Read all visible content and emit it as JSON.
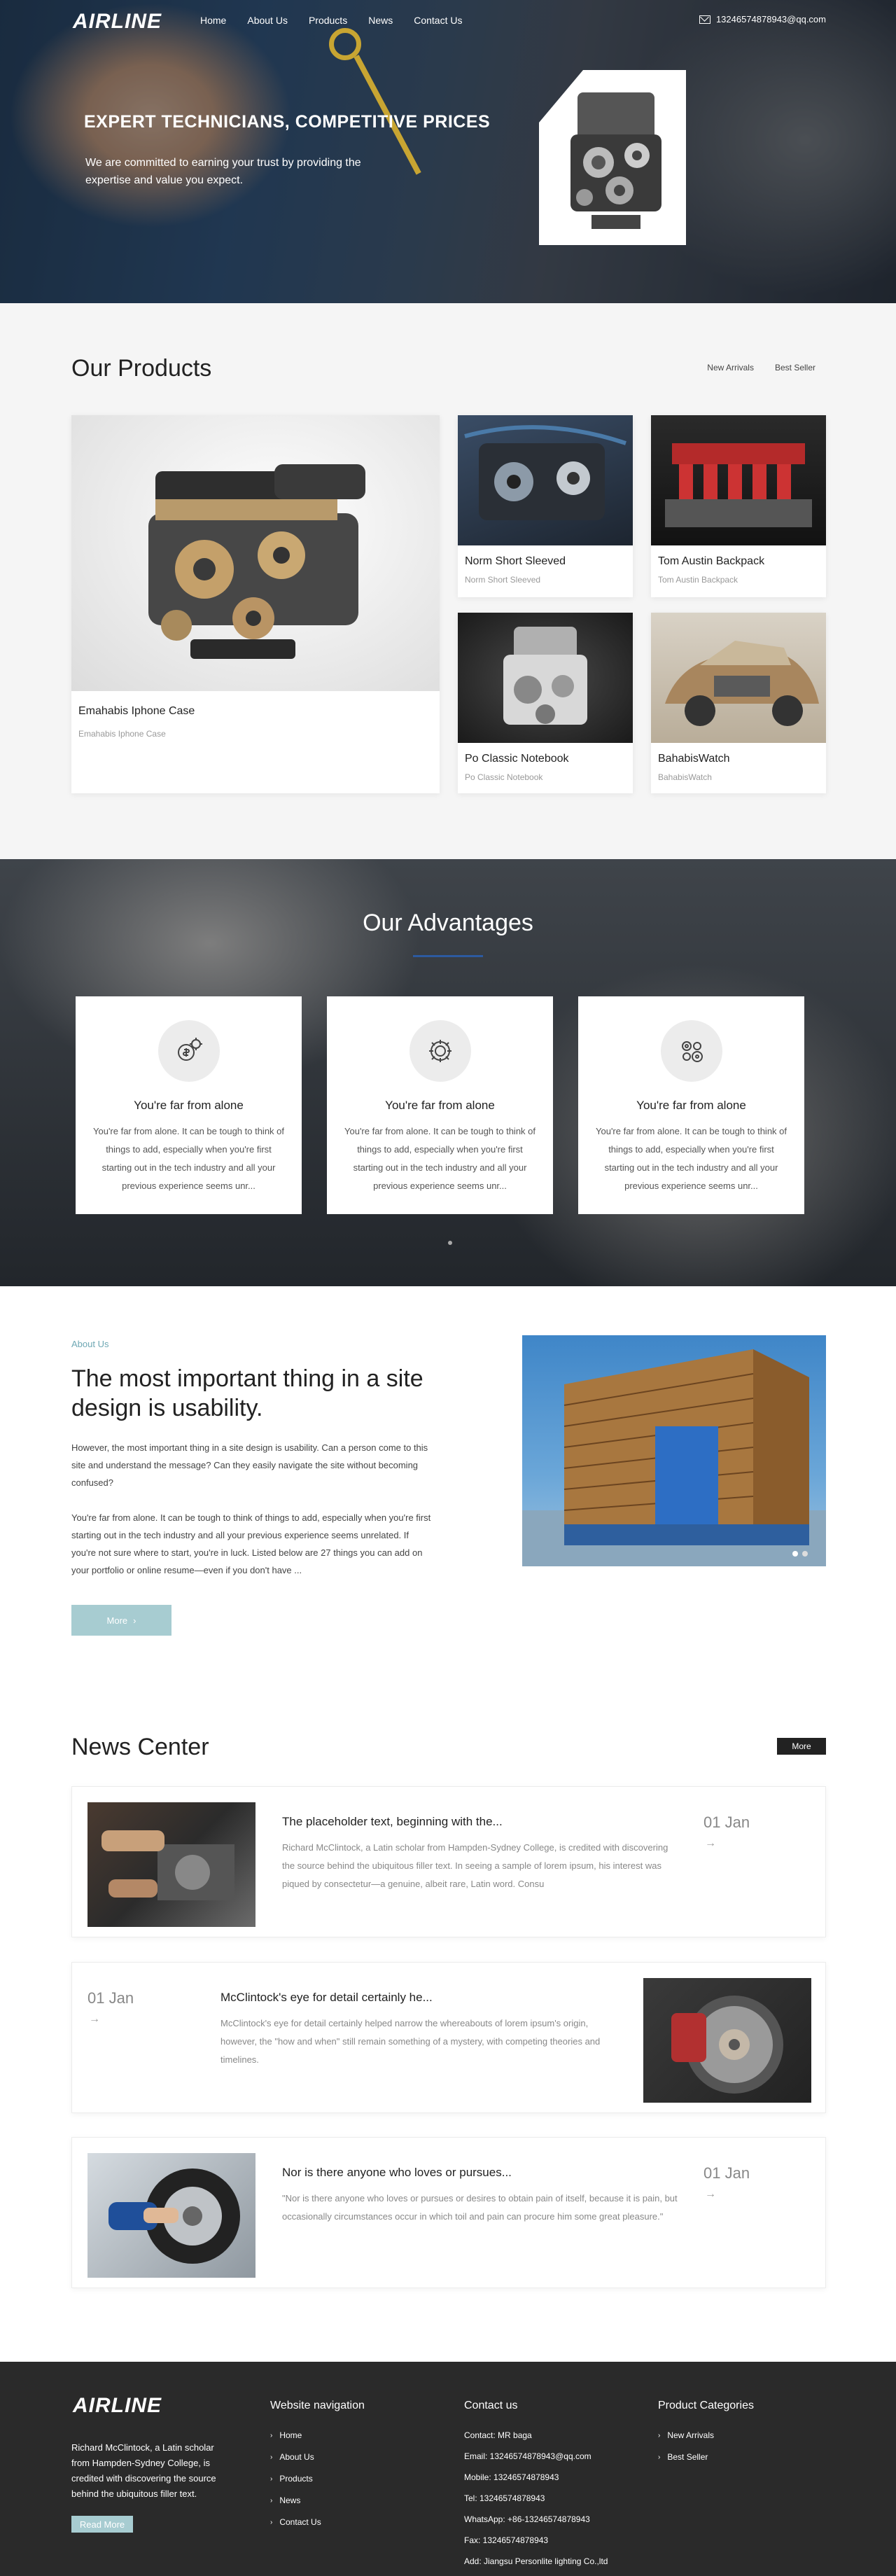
{
  "header": {
    "logo": "AIRLINE",
    "nav": [
      "Home",
      "About Us",
      "Products",
      "News",
      "Contact Us"
    ],
    "email": "13246574878943@qq.com"
  },
  "hero": {
    "title": "EXPERT TECHNICIANS, COMPETITIVE PRICES",
    "subtitle": "We are committed to earning your trust by providing the expertise and value you expect."
  },
  "products": {
    "title": "Our Products",
    "tabs": [
      "New Arrivals",
      "Best Seller"
    ],
    "items": [
      {
        "title": "Emahabis Iphone Case",
        "subtitle": "Emahabis Iphone Case"
      },
      {
        "title": "Norm Short Sleeved",
        "subtitle": "Norm Short Sleeved"
      },
      {
        "title": "Tom Austin Backpack",
        "subtitle": "Tom Austin Backpack"
      },
      {
        "title": "Po Classic Notebook",
        "subtitle": "Po Classic Notebook"
      },
      {
        "title": "BahabisWatch",
        "subtitle": "BahabisWatch"
      }
    ]
  },
  "advantages": {
    "title": "Our Advantages",
    "items": [
      {
        "title": "You're far from alone",
        "text": "You're far from alone. It can be tough to think of things to add, especially when you're first starting out in the tech industry and all your previous experience seems unr..."
      },
      {
        "title": "You're far from alone",
        "text": "You're far from alone. It can be tough to think of things to add, especially when you're first starting out in the tech industry and all your previous experience seems unr..."
      },
      {
        "title": "You're far from alone",
        "text": "You're far from alone. It can be tough to think of things to add, especially when you're first starting out in the tech industry and all your previous experience seems unr..."
      }
    ]
  },
  "about": {
    "label": "About Us",
    "title": "The most important thing in a site design is usability.",
    "p1": "However, the most important thing in a site design is usability. Can a person come to this site and understand the message? Can they easily navigate the site without becoming confused?",
    "p2": "You're far from alone. It can be tough to think of things to add, especially when you're first starting out in the tech industry and all your previous experience seems unrelated. If you're not sure where to start, you're in luck. Listed below are 27 things you can add on your portfolio or online resume—even if you don't have ...",
    "more": "More"
  },
  "news": {
    "title": "News Center",
    "more": "More",
    "items": [
      {
        "title": "The placeholder text, beginning with the...",
        "excerpt": "Richard McClintock, a Latin scholar from Hampden-Sydney College, is credited with discovering the source behind the ubiquitous filler text. In seeing a sample of lorem ipsum, his interest was piqued by consectetur—a genuine, albeit rare, Latin word. Consu",
        "date": "01 Jan"
      },
      {
        "title": "McClintock's eye for detail certainly he...",
        "excerpt": "McClintock's eye for detail certainly helped narrow the whereabouts of lorem ipsum's origin, however, the \"how and when\" still remain something of a mystery, with competing theories and timelines.",
        "date": "01 Jan"
      },
      {
        "title": "Nor is there anyone who loves or pursues...",
        "excerpt": "\"Nor is there anyone who loves or pursues or desires to obtain pain of itself, because it is pain, but occasionally circumstances occur in which toil and pain can procure him some great pleasure.\"",
        "date": "01 Jan"
      }
    ]
  },
  "footer": {
    "logo": "AIRLINE",
    "about": "Richard McClintock, a Latin scholar from Hampden-Sydney College, is credited with discovering the source behind the ubiquitous filler text.",
    "read_more": "Read More",
    "nav_title": "Website navigation",
    "nav": [
      "Home",
      "About Us",
      "Products",
      "News",
      "Contact Us"
    ],
    "contact_title": "Contact us",
    "contact": [
      "Contact: MR baga",
      "Email: 13246574878943@qq.com",
      "Mobile: 13246574878943",
      "Tel: 13246574878943",
      "WhatsApp: +86-13246574878943",
      "Fax: 13246574878943",
      "Add: Jiangsu Personlite lighting Co.,ltd"
    ],
    "cat_title": "Product Categories",
    "categories": [
      "New Arrivals",
      "Best Seller"
    ]
  },
  "colors": {
    "accent": "#2c5aa0",
    "button": "#a7ccd1",
    "footer": "#2a2a2a",
    "section_bg": "#f5f5f5"
  }
}
